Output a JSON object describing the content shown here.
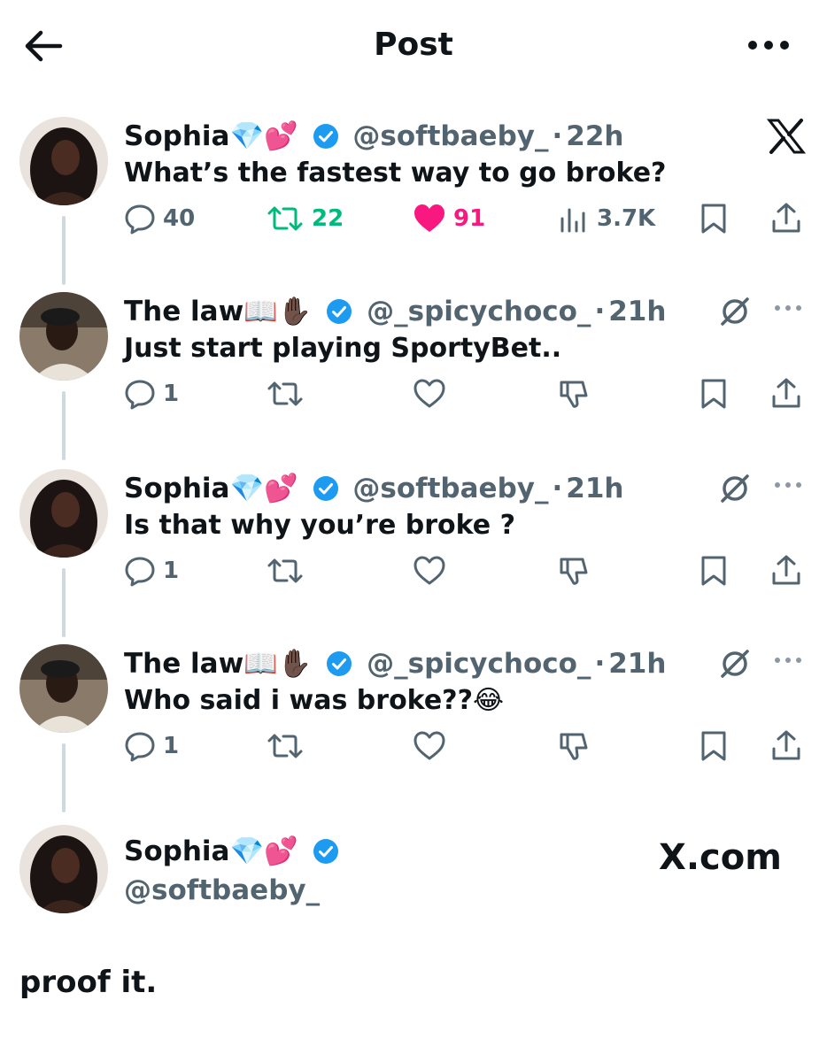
{
  "header": {
    "title": "Post"
  },
  "colors": {
    "text": "#0f1419",
    "secondary": "#536471",
    "verified": "#1d9bf0",
    "retweet": "#00ba7c",
    "like": "#f91880",
    "line": "#cfd9de"
  },
  "tweets": [
    {
      "name": "Sophia",
      "emojis": [
        "💎",
        "💕"
      ],
      "handle": "@softbaeby_",
      "time": "22h",
      "text": "What’s the fastest way to go broke?",
      "replies": "40",
      "retweets": "22",
      "likes": "91",
      "views": "3.7K",
      "liked": true,
      "retweeted": true,
      "icon_right": "x-logo-icon"
    },
    {
      "name": "The law",
      "emojis": [
        "📖",
        "✋🏿"
      ],
      "handle": "@_spicychoco_",
      "time": "21h",
      "text": "Just start playing SportyBet..",
      "replies": "1",
      "icon_right": "grok-icon"
    },
    {
      "name": "Sophia",
      "emojis": [
        "💎",
        "💕"
      ],
      "handle": "@softbaeby_",
      "time": "21h",
      "text": "Is that why you’re broke ?",
      "replies": "1",
      "icon_right": "grok-icon"
    },
    {
      "name": "The law",
      "emojis": [
        "📖",
        "✋🏿"
      ],
      "handle": "@_spicychoco_",
      "time": "21h",
      "text": "Who said i was broke??",
      "text_emoji": "😂",
      "replies": "1",
      "icon_right": "grok-icon"
    }
  ],
  "profile_card": {
    "name": "Sophia",
    "emojis": [
      "💎",
      "💕"
    ],
    "handle": "@softbaeby_",
    "site": "X.com"
  },
  "caption": "proof it."
}
